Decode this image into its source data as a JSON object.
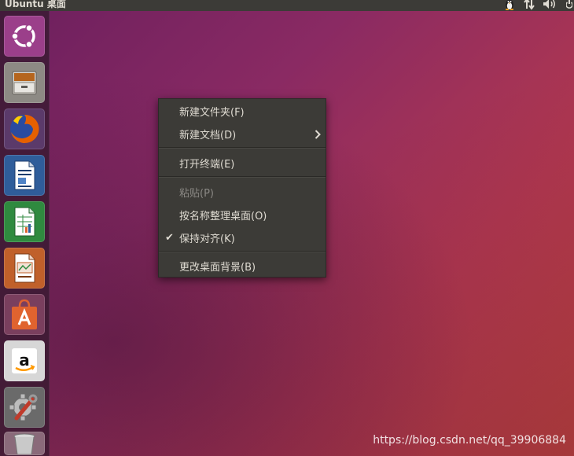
{
  "top_bar": {
    "title": "Ubuntu 桌面",
    "indicators": [
      "tux-icon",
      "network-arrows-icon",
      "volume-icon",
      "power-icon"
    ]
  },
  "launcher": {
    "items": [
      {
        "name": "ubuntu-dash",
        "icon": "ubuntu-logo-icon",
        "color": "#9b3f8a"
      },
      {
        "name": "files",
        "icon": "file-cabinet-icon",
        "color": "#8d8a84"
      },
      {
        "name": "firefox",
        "icon": "firefox-icon",
        "color": "#d9612c"
      },
      {
        "name": "libreoffice-writer",
        "icon": "writer-doc-icon",
        "color": "#2f5d9a"
      },
      {
        "name": "libreoffice-calc",
        "icon": "calc-sheet-icon",
        "color": "#2f8a3f"
      },
      {
        "name": "libreoffice-impress",
        "icon": "impress-slide-icon",
        "color": "#c0602a"
      },
      {
        "name": "ubuntu-software",
        "icon": "shopping-bag-icon",
        "color": "#e0632f"
      },
      {
        "name": "amazon",
        "icon": "amazon-icon",
        "color": "#d7d7d7"
      },
      {
        "name": "system-settings",
        "icon": "gear-wrench-icon",
        "color": "#6a6a6a"
      },
      {
        "name": "trash",
        "icon": "trash-icon",
        "color": "#8a6a7a"
      }
    ]
  },
  "context_menu": {
    "items": [
      {
        "label": "新建文件夹(F)",
        "enabled": true
      },
      {
        "label": "新建文档(D)",
        "enabled": true,
        "submenu": true
      },
      {
        "label": "打开终端(E)",
        "enabled": true
      },
      {
        "label": "粘贴(P)",
        "enabled": false
      },
      {
        "label": "按名称整理桌面(O)",
        "enabled": true
      },
      {
        "label": "保持对齐(K)",
        "enabled": true,
        "checked": true
      },
      {
        "label": "更改桌面背景(B)",
        "enabled": true
      }
    ],
    "check_glyph": "✔"
  },
  "watermark": "https://blog.csdn.net/qq_39906884"
}
